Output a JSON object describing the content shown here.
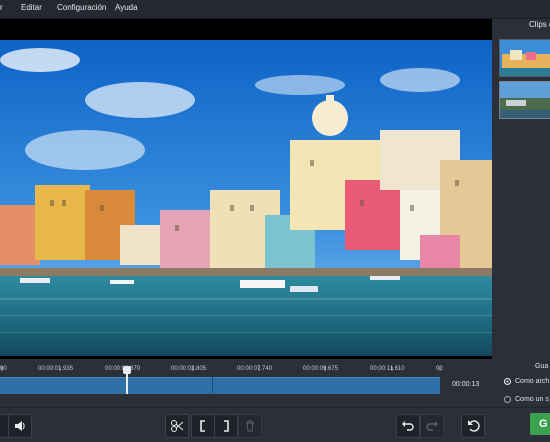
{
  "menu": {
    "items": [
      "r",
      "Editar",
      "Configuración",
      "Ayuda"
    ]
  },
  "sidebar": {
    "title": "Clips d"
  },
  "timeline": {
    "ticks": [
      "00",
      "00:00:01.935",
      "00:00:02.870",
      "00:00:03.805",
      "00:00:07.740",
      "00:00:09.675",
      "00:00:11.610",
      "00"
    ],
    "duration": "00:00:13",
    "playhead_time": "00:00:02.870"
  },
  "save": {
    "title": "Gua",
    "options": [
      "Como arch",
      "Como un s"
    ],
    "selected_option": 0,
    "button_label": "G"
  },
  "icons": {
    "volume": "speaker-icon",
    "cut": "scissors-icon",
    "mark_in": "bracket-left-icon",
    "mark_out": "bracket-right-icon",
    "delete": "trash-icon",
    "undo": "undo-icon",
    "redo": "redo-icon",
    "reset": "rotate-left-icon"
  },
  "colors": {
    "accent": "#3aa14c",
    "track": "#2f6fa8",
    "background": "#2b3038"
  }
}
